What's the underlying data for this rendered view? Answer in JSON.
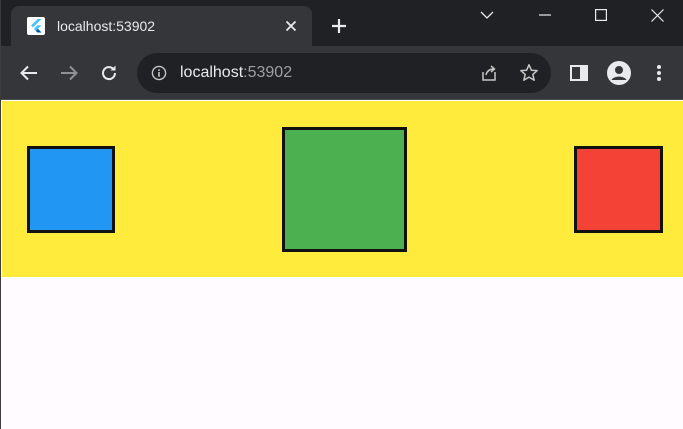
{
  "browser": {
    "tab": {
      "title": "localhost:53902"
    },
    "address": {
      "host": "localhost",
      "port": ":53902"
    }
  },
  "icons": {
    "favicon": "flutter-icon",
    "tab_close": "close-icon",
    "new_tab": "plus-icon",
    "tab_search": "chevron-down-icon",
    "minimize": "minimize-icon",
    "maximize": "maximize-icon",
    "close_window": "close-icon",
    "back": "arrow-left-icon",
    "forward": "arrow-right-icon",
    "reload": "reload-icon",
    "site_info": "info-icon",
    "share": "share-icon",
    "bookmark": "star-icon",
    "side_panel": "side-panel-icon",
    "profile": "profile-icon",
    "menu": "kebab-menu-icon"
  },
  "page": {
    "banner_color": "#ffeb3b",
    "background_color": "#fffbfe",
    "boxes": [
      {
        "name": "blue",
        "color": "#2196f3"
      },
      {
        "name": "green",
        "color": "#4caf50"
      },
      {
        "name": "red",
        "color": "#f44336"
      }
    ]
  }
}
